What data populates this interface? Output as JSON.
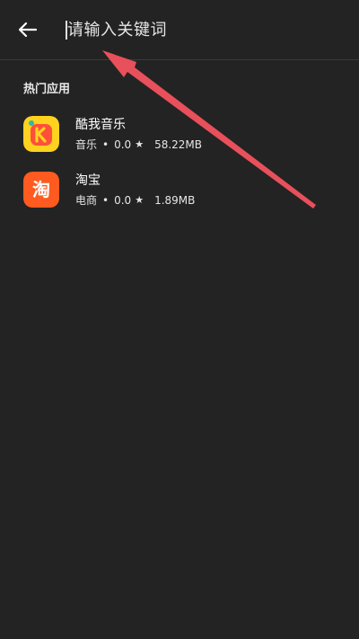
{
  "header": {
    "search_placeholder": "请输入关键词"
  },
  "hot_apps": {
    "title": "热门应用",
    "items": [
      {
        "name": "酷我音乐",
        "category": "音乐",
        "rating": "0.0",
        "size": "58.22MB"
      },
      {
        "name": "淘宝",
        "category": "电商",
        "rating": "0.0",
        "size": "1.89MB"
      }
    ]
  },
  "icons": {
    "back": "arrow-left-icon",
    "star": "star-icon",
    "kuwo": "kuwo-music-icon",
    "taobao": "taobao-icon"
  },
  "colors": {
    "background": "#232323",
    "kuwo_yellow": "#FFD21F",
    "taobao_orange": "#FF5A1F",
    "annotation_arrow": "#E8505B"
  },
  "separators": {
    "dot": "•",
    "star": "★"
  }
}
